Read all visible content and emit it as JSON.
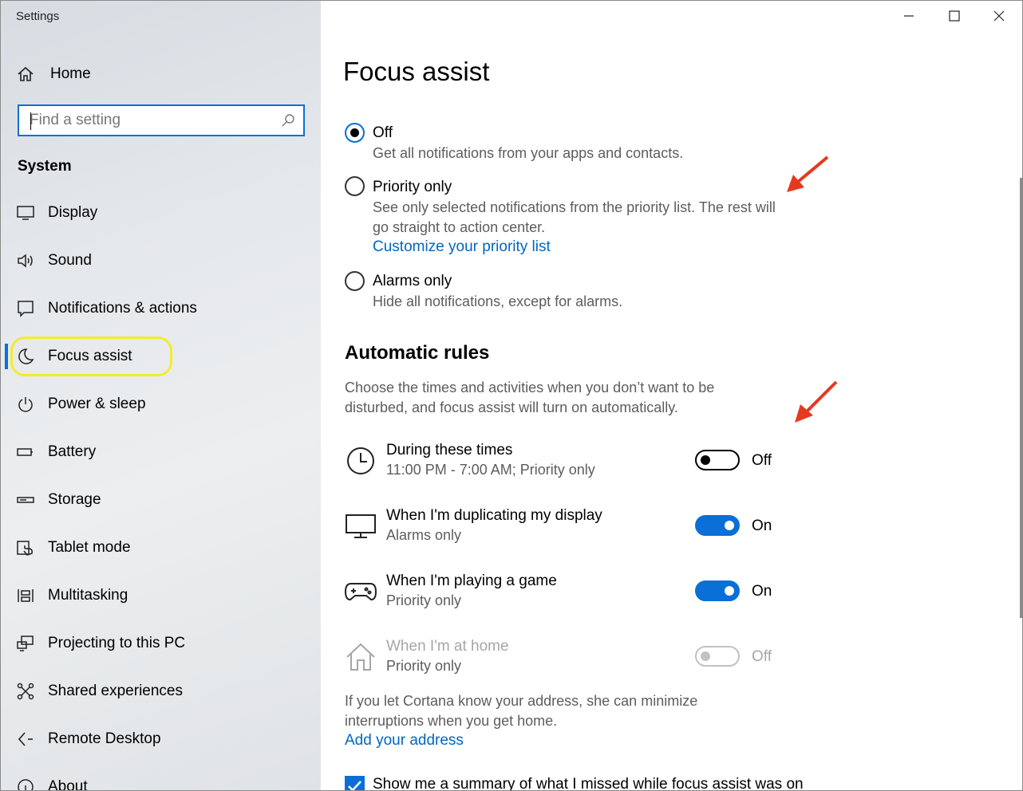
{
  "window": {
    "title": "Settings"
  },
  "sidebar": {
    "home_label": "Home",
    "search_placeholder": "Find a setting",
    "section_label": "System",
    "items": [
      {
        "label": "Display",
        "icon": "display-icon"
      },
      {
        "label": "Sound",
        "icon": "speaker-icon"
      },
      {
        "label": "Notifications & actions",
        "icon": "notification-icon"
      },
      {
        "label": "Focus assist",
        "icon": "moon-icon",
        "active": true
      },
      {
        "label": "Power & sleep",
        "icon": "power-icon"
      },
      {
        "label": "Battery",
        "icon": "battery-icon"
      },
      {
        "label": "Storage",
        "icon": "storage-icon"
      },
      {
        "label": "Tablet mode",
        "icon": "tablet-mode-icon"
      },
      {
        "label": "Multitasking",
        "icon": "multitasking-icon"
      },
      {
        "label": "Projecting to this PC",
        "icon": "projecting-icon"
      },
      {
        "label": "Shared experiences",
        "icon": "shared-experiences-icon"
      },
      {
        "label": "Remote Desktop",
        "icon": "remote-desktop-icon"
      },
      {
        "label": "About",
        "icon": "info-icon"
      }
    ]
  },
  "main": {
    "title": "Focus assist",
    "options": [
      {
        "label": "Off",
        "desc": "Get all notifications from your apps and contacts.",
        "selected": true
      },
      {
        "label": "Priority only",
        "desc": "See only selected notifications from the priority list. The rest will go straight to action center.",
        "link": "Customize your priority list",
        "selected": false
      },
      {
        "label": "Alarms only",
        "desc": "Hide all notifications, except for alarms.",
        "selected": false
      }
    ],
    "rules_heading": "Automatic rules",
    "rules_intro": "Choose the times and activities when you don’t want to be disturbed, and focus assist will turn on automatically.",
    "rules": [
      {
        "title": "During these times",
        "subtitle": "11:00 PM - 7:00 AM; Priority only",
        "state": "Off",
        "icon": "clock-icon"
      },
      {
        "title": "When I'm duplicating my display",
        "subtitle": "Alarms only",
        "state": "On",
        "icon": "monitor-icon"
      },
      {
        "title": "When I'm playing a game",
        "subtitle": "Priority only",
        "state": "On",
        "icon": "gamepad-icon"
      },
      {
        "title": "When I'm at home",
        "subtitle": "Priority only",
        "state": "Off",
        "icon": "house-icon",
        "disabled": true
      }
    ],
    "cortana_text": "If you let Cortana know your address, she can minimize interruptions when you get home.",
    "address_link": "Add your address",
    "summary_checkbox": {
      "label": "Show me a summary of what I missed while focus assist was on",
      "checked": true
    }
  },
  "colors": {
    "accent": "#0a6fd6",
    "link": "#0067c0",
    "highlight_ring": "#f3ec2d",
    "annotation_arrow": "#e5391f"
  }
}
